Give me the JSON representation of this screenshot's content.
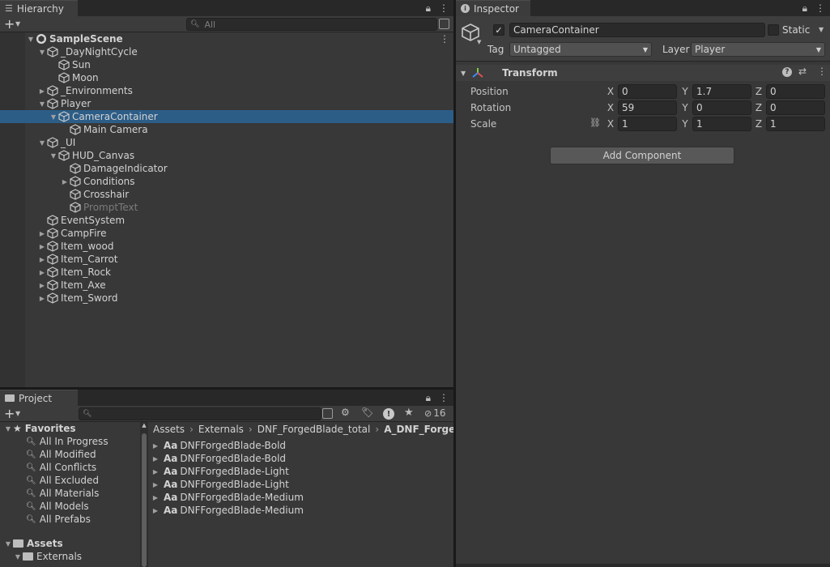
{
  "hierarchy": {
    "tab_label": "Hierarchy",
    "search_placeholder": "All",
    "items": [
      {
        "label": "SampleScene",
        "depth": 0,
        "arrow": "down",
        "icon": "unity-scene-icon",
        "bold": true
      },
      {
        "label": "_DayNightCycle",
        "depth": 1,
        "arrow": "down",
        "icon": "cube-icon"
      },
      {
        "label": "Sun",
        "depth": 2,
        "arrow": "",
        "icon": "cube-icon"
      },
      {
        "label": "Moon",
        "depth": 2,
        "arrow": "",
        "icon": "cube-icon"
      },
      {
        "label": "_Environments",
        "depth": 1,
        "arrow": "right",
        "icon": "cube-icon"
      },
      {
        "label": "Player",
        "depth": 1,
        "arrow": "down",
        "icon": "cube-icon"
      },
      {
        "label": "CameraContainer",
        "depth": 2,
        "arrow": "down",
        "icon": "cube-icon",
        "selected": true
      },
      {
        "label": "Main Camera",
        "depth": 3,
        "arrow": "",
        "icon": "cube-icon"
      },
      {
        "label": "_UI",
        "depth": 1,
        "arrow": "down",
        "icon": "cube-icon"
      },
      {
        "label": "HUD_Canvas",
        "depth": 2,
        "arrow": "down",
        "icon": "cube-icon"
      },
      {
        "label": "DamageIndicator",
        "depth": 3,
        "arrow": "",
        "icon": "cube-icon"
      },
      {
        "label": "Conditions",
        "depth": 3,
        "arrow": "right",
        "icon": "cube-icon"
      },
      {
        "label": "Crosshair",
        "depth": 3,
        "arrow": "",
        "icon": "cube-icon"
      },
      {
        "label": "PromptText",
        "depth": 3,
        "arrow": "",
        "icon": "cube-icon",
        "muted": true
      },
      {
        "label": "EventSystem",
        "depth": 1,
        "arrow": "",
        "icon": "cube-icon"
      },
      {
        "label": "CampFire",
        "depth": 1,
        "arrow": "right",
        "icon": "cube-icon"
      },
      {
        "label": "Item_wood",
        "depth": 1,
        "arrow": "right",
        "icon": "cube-icon"
      },
      {
        "label": "Item_Carrot",
        "depth": 1,
        "arrow": "right",
        "icon": "cube-icon"
      },
      {
        "label": "Item_Rock",
        "depth": 1,
        "arrow": "right",
        "icon": "cube-icon"
      },
      {
        "label": "Item_Axe",
        "depth": 1,
        "arrow": "right",
        "icon": "cube-icon"
      },
      {
        "label": "Item_Sword",
        "depth": 1,
        "arrow": "right",
        "icon": "cube-icon"
      }
    ]
  },
  "project": {
    "tab_label": "Project",
    "hidden_count": "16",
    "favorites_label": "Favorites",
    "favorites": [
      "All In Progress",
      "All Modified",
      "All Conflicts",
      "All Excluded",
      "All Materials",
      "All Models",
      "All Prefabs"
    ],
    "assets_label": "Assets",
    "externals_label": "Externals",
    "breadcrumb": [
      "Assets",
      "Externals",
      "DNF_ForgedBlade_total",
      "A_DNF_ForgedBl"
    ],
    "font_prefix": "Aa",
    "files": [
      "DNFForgedBlade-Bold",
      "DNFForgedBlade-Bold",
      "DNFForgedBlade-Light",
      "DNFForgedBlade-Light",
      "DNFForgedBlade-Medium",
      "DNFForgedBlade-Medium"
    ]
  },
  "inspector": {
    "tab_label": "Inspector",
    "object_name": "CameraContainer",
    "static_label": "Static",
    "tag_label": "Tag",
    "tag_value": "Untagged",
    "layer_label": "Layer",
    "layer_value": "Player",
    "component_title": "Transform",
    "position_label": "Position",
    "rotation_label": "Rotation",
    "scale_label": "Scale",
    "axis_x": "X",
    "axis_y": "Y",
    "axis_z": "Z",
    "position": {
      "x": "0",
      "y": "1.7",
      "z": "0"
    },
    "rotation": {
      "x": "59",
      "y": "0",
      "z": "0"
    },
    "scale": {
      "x": "1",
      "y": "1",
      "z": "1"
    },
    "add_component_label": "Add Component"
  },
  "colors": {
    "selection": "#2c5d87",
    "panel": "#383838",
    "field": "#2a2a2a"
  }
}
